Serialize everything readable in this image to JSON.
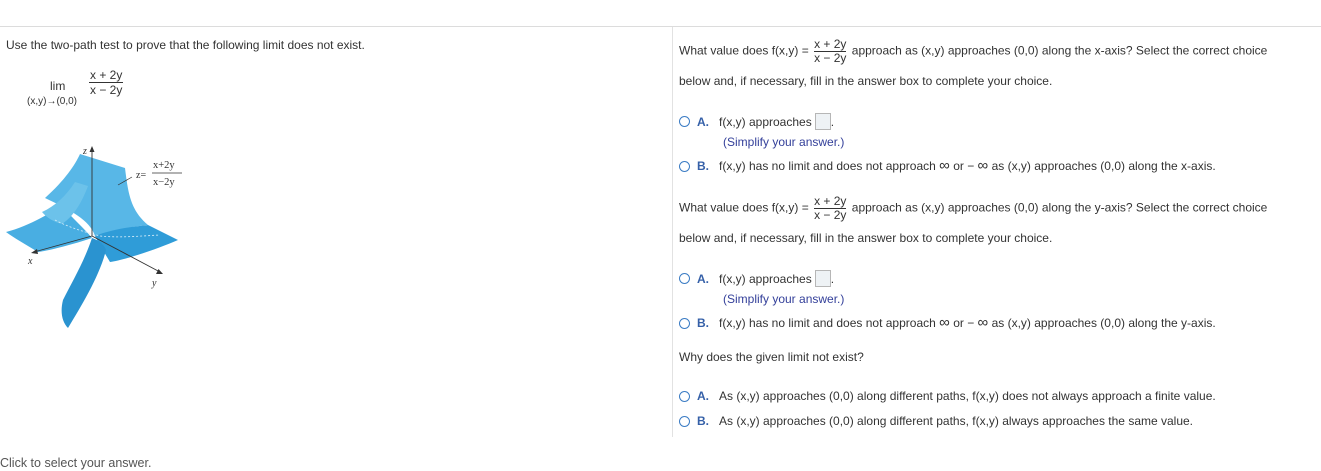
{
  "left": {
    "instruction": "Use the two-path test to prove that the following limit does not exist.",
    "limit": {
      "word": "lim",
      "subscript": "(x,y)→(0,0)",
      "numerator": "x + 2y",
      "denominator": "x − 2y"
    },
    "graph": {
      "axis_x": "x",
      "axis_y": "y",
      "axis_z": "z",
      "formula_lhs": "z=",
      "formula_num": "x+2y",
      "formula_den": "x−2y",
      "surface_color": "#35a2dc"
    },
    "footer": "Click to select your answer."
  },
  "q1": {
    "lead": "What value does f(x,y) =",
    "frac_num": "x + 2y",
    "frac_den": "x − 2y",
    "tail": "approach as (x,y) approaches (0,0) along the x-axis? Select the correct choice",
    "line2": "below and, if necessary, fill in the answer box to complete your choice.",
    "optA_letter": "A.",
    "optA_text": "f(x,y) approaches",
    "optA_hint": "(Simplify your answer.)",
    "optB_letter": "B.",
    "optB_pre": "f(x,y) has no limit and does not approach",
    "optB_mid": "or −",
    "optB_post": "as (x,y) approaches (0,0) along the x-axis."
  },
  "q2": {
    "lead": "What value does f(x,y) =",
    "frac_num": "x + 2y",
    "frac_den": "x − 2y",
    "tail": "approach as (x,y) approaches (0,0) along the y-axis? Select the correct choice",
    "line2": "below and, if necessary, fill in the answer box to complete your choice.",
    "optA_letter": "A.",
    "optA_text": "f(x,y) approaches",
    "optA_hint": "(Simplify your answer.)",
    "optB_letter": "B.",
    "optB_pre": "f(x,y) has no limit and does not approach",
    "optB_mid": "or −",
    "optB_post": "as (x,y) approaches (0,0) along the y-axis."
  },
  "q3": {
    "question": "Why does the given limit not exist?",
    "optA_letter": "A.",
    "optA_text": "As (x,y) approaches (0,0) along different paths, f(x,y) does not always approach a finite value.",
    "optB_letter": "B.",
    "optB_text": "As (x,y) approaches (0,0) along different paths, f(x,y) always approaches the same value."
  },
  "symbols": {
    "infinity": "∞",
    "period": "."
  },
  "colors": {
    "option_letter": "#3560a8",
    "radio_border": "#3b7cc4",
    "hint": "#34409a",
    "divider": "#dcdcdc"
  }
}
